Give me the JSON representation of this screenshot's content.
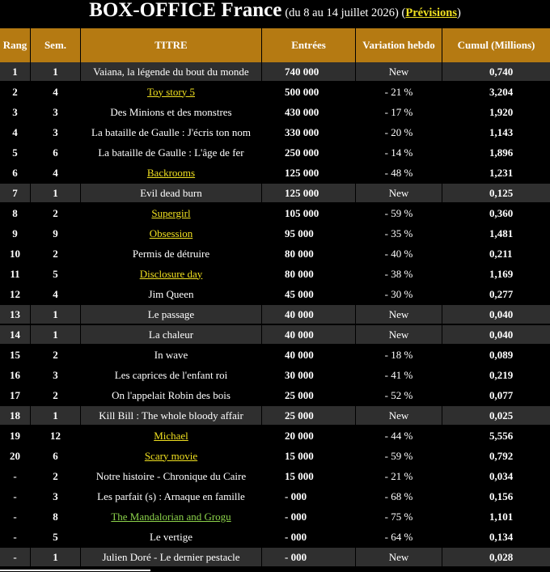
{
  "header": {
    "title": "BOX-OFFICE France",
    "subtitle_prefix": "(du 8 au 14 juillet 2026) (",
    "link_label": "Prévisions",
    "subtitle_suffix": ")"
  },
  "colors": {
    "header_bg": "#b57a12",
    "link": "#f0e020",
    "link_alt": "#8bd14a",
    "new_row_bg": "#2f2f2f"
  },
  "columns": [
    "Rang",
    "Sem.",
    "TITRE",
    "Entrées",
    "Variation hebdo",
    "Cumul (Millions)"
  ],
  "rows": [
    {
      "rang": "1",
      "sem": "1",
      "titre": "Vaiana, la légende du bout du monde",
      "entrees": "740 000",
      "variation": "New",
      "cumul": "0,740",
      "link": ""
    },
    {
      "rang": "2",
      "sem": "4",
      "titre": "Toy story 5",
      "entrees": "500 000",
      "variation": "- 21 %",
      "cumul": "3,204",
      "link": "yellow"
    },
    {
      "rang": "3",
      "sem": "3",
      "titre": "Des Minions et des monstres",
      "entrees": "430 000",
      "variation": "- 17 %",
      "cumul": "1,920",
      "link": ""
    },
    {
      "rang": "4",
      "sem": "3",
      "titre": "La bataille de Gaulle : J'écris ton nom",
      "entrees": "330 000",
      "variation": "- 20 %",
      "cumul": "1,143",
      "link": ""
    },
    {
      "rang": "5",
      "sem": "6",
      "titre": "La bataille de Gaulle : L'âge de fer",
      "entrees": "250 000",
      "variation": "- 14 %",
      "cumul": "1,896",
      "link": ""
    },
    {
      "rang": "6",
      "sem": "4",
      "titre": "Backrooms",
      "entrees": "125 000",
      "variation": "- 48 %",
      "cumul": "1,231",
      "link": "yellow"
    },
    {
      "rang": "7",
      "sem": "1",
      "titre": "Evil dead burn",
      "entrees": "125 000",
      "variation": "New",
      "cumul": "0,125",
      "link": ""
    },
    {
      "rang": "8",
      "sem": "2",
      "titre": "Supergirl",
      "entrees": "105 000",
      "variation": "- 59 %",
      "cumul": "0,360",
      "link": "yellow"
    },
    {
      "rang": "9",
      "sem": "9",
      "titre": "Obsession",
      "entrees": "95 000",
      "variation": "- 35 %",
      "cumul": "1,481",
      "link": "yellow"
    },
    {
      "rang": "10",
      "sem": "2",
      "titre": "Permis de détruire",
      "entrees": "80 000",
      "variation": "- 40 %",
      "cumul": "0,211",
      "link": ""
    },
    {
      "rang": "11",
      "sem": "5",
      "titre": "Disclosure day",
      "entrees": "80 000",
      "variation": "- 38 %",
      "cumul": "1,169",
      "link": "yellow"
    },
    {
      "rang": "12",
      "sem": "4",
      "titre": "Jim Queen",
      "entrees": "45 000",
      "variation": "- 30 %",
      "cumul": "0,277",
      "link": ""
    },
    {
      "rang": "13",
      "sem": "1",
      "titre": "Le passage",
      "entrees": "40 000",
      "variation": "New",
      "cumul": "0,040",
      "link": ""
    },
    {
      "rang": "14",
      "sem": "1",
      "titre": "La chaleur",
      "entrees": "40 000",
      "variation": "New",
      "cumul": "0,040",
      "link": ""
    },
    {
      "rang": "15",
      "sem": "2",
      "titre": "In wave",
      "entrees": "40 000",
      "variation": "- 18 %",
      "cumul": "0,089",
      "link": ""
    },
    {
      "rang": "16",
      "sem": "3",
      "titre": "Les caprices de l'enfant roi",
      "entrees": "30 000",
      "variation": "- 41 %",
      "cumul": "0,219",
      "link": ""
    },
    {
      "rang": "17",
      "sem": "2",
      "titre": "On l'appelait Robin des bois",
      "entrees": "25 000",
      "variation": "- 52 %",
      "cumul": "0,077",
      "link": ""
    },
    {
      "rang": "18",
      "sem": "1",
      "titre": "Kill Bill : The whole bloody affair",
      "entrees": "25 000",
      "variation": "New",
      "cumul": "0,025",
      "link": ""
    },
    {
      "rang": "19",
      "sem": "12",
      "titre": "Michael",
      "entrees": "20 000",
      "variation": "- 44 %",
      "cumul": "5,556",
      "link": "yellow"
    },
    {
      "rang": "20",
      "sem": "6",
      "titre": "Scary movie",
      "entrees": "15 000",
      "variation": "- 59 %",
      "cumul": "0,792",
      "link": "yellow"
    },
    {
      "rang": "-",
      "sem": "2",
      "titre": "Notre histoire - Chronique du Caire",
      "entrees": "15 000",
      "variation": "- 21 %",
      "cumul": "0,034",
      "link": ""
    },
    {
      "rang": "-",
      "sem": "3",
      "titre": "Les parfait (s) : Arnaque en famille",
      "entrees": "- 000",
      "variation": "- 68 %",
      "cumul": "0,156",
      "link": ""
    },
    {
      "rang": "-",
      "sem": "8",
      "titre": "The Mandalorian and Grogu",
      "entrees": "- 000",
      "variation": "- 75 %",
      "cumul": "1,101",
      "link": "green"
    },
    {
      "rang": "-",
      "sem": "5",
      "titre": "Le vertige",
      "entrees": "- 000",
      "variation": "- 64 %",
      "cumul": "0,134",
      "link": ""
    },
    {
      "rang": "-",
      "sem": "1",
      "titre": "Julien Doré - Le dernier pestacle",
      "entrees": "- 000",
      "variation": "New",
      "cumul": "0,028",
      "link": ""
    }
  ]
}
